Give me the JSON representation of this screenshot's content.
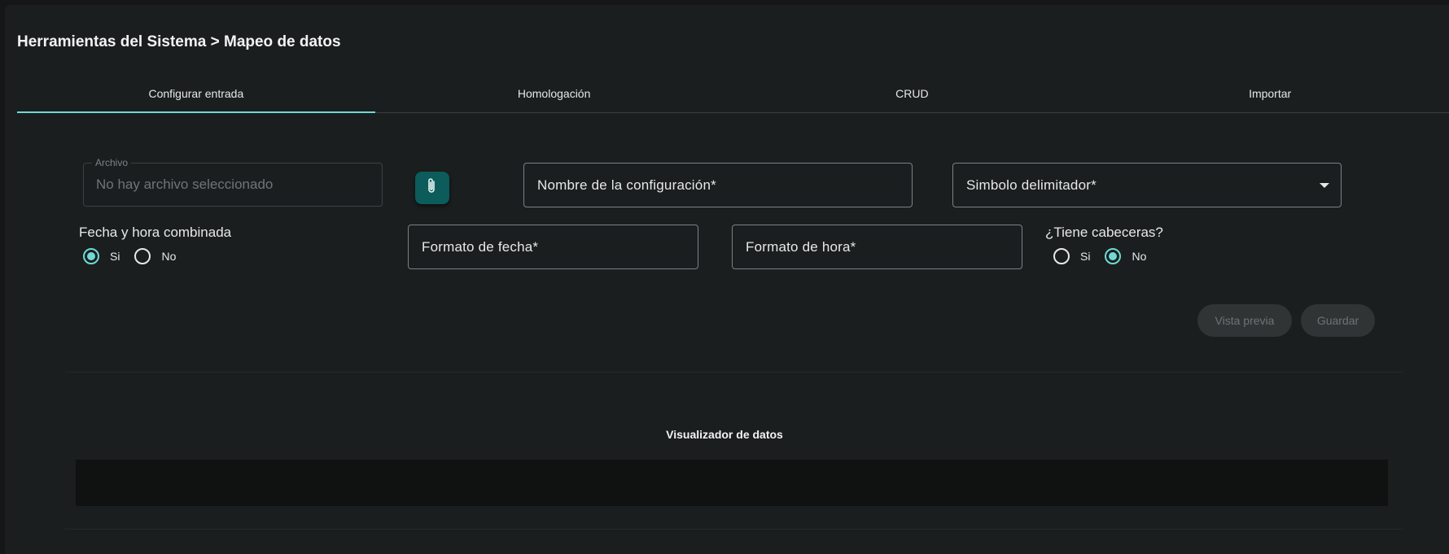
{
  "breadcrumb": "Herramientas del Sistema > Mapeo de datos",
  "tabs": [
    {
      "label": "Configurar entrada",
      "active": true
    },
    {
      "label": "Homologación",
      "active": false
    },
    {
      "label": "CRUD",
      "active": false
    },
    {
      "label": "Importar",
      "active": false
    }
  ],
  "form": {
    "archivo": {
      "legend": "Archivo",
      "placeholder": "No hay archivo seleccionado"
    },
    "attach_icon": "paperclip-icon",
    "nombre_configuracion": "Nombre de la configuración*",
    "simbolo_delimitador": "Simbolo delimitador*",
    "fecha_hora_combinada": {
      "title": "Fecha y hora combinada",
      "options": [
        "Si",
        "No"
      ],
      "selected": "Si"
    },
    "formato_fecha": "Formato de fecha*",
    "formato_hora": "Formato de hora*",
    "tiene_cabeceras": {
      "title": "¿Tiene cabeceras?",
      "options": [
        "Si",
        "No"
      ],
      "selected": "No"
    },
    "buttons": {
      "preview": "Vista previa",
      "save": "Guardar"
    }
  },
  "visualizer": {
    "title": "Visualizador de datos"
  },
  "colors": {
    "accent": "#6fd9d3",
    "attach_button": "#0b5c5b",
    "background": "#1b1e1f"
  }
}
